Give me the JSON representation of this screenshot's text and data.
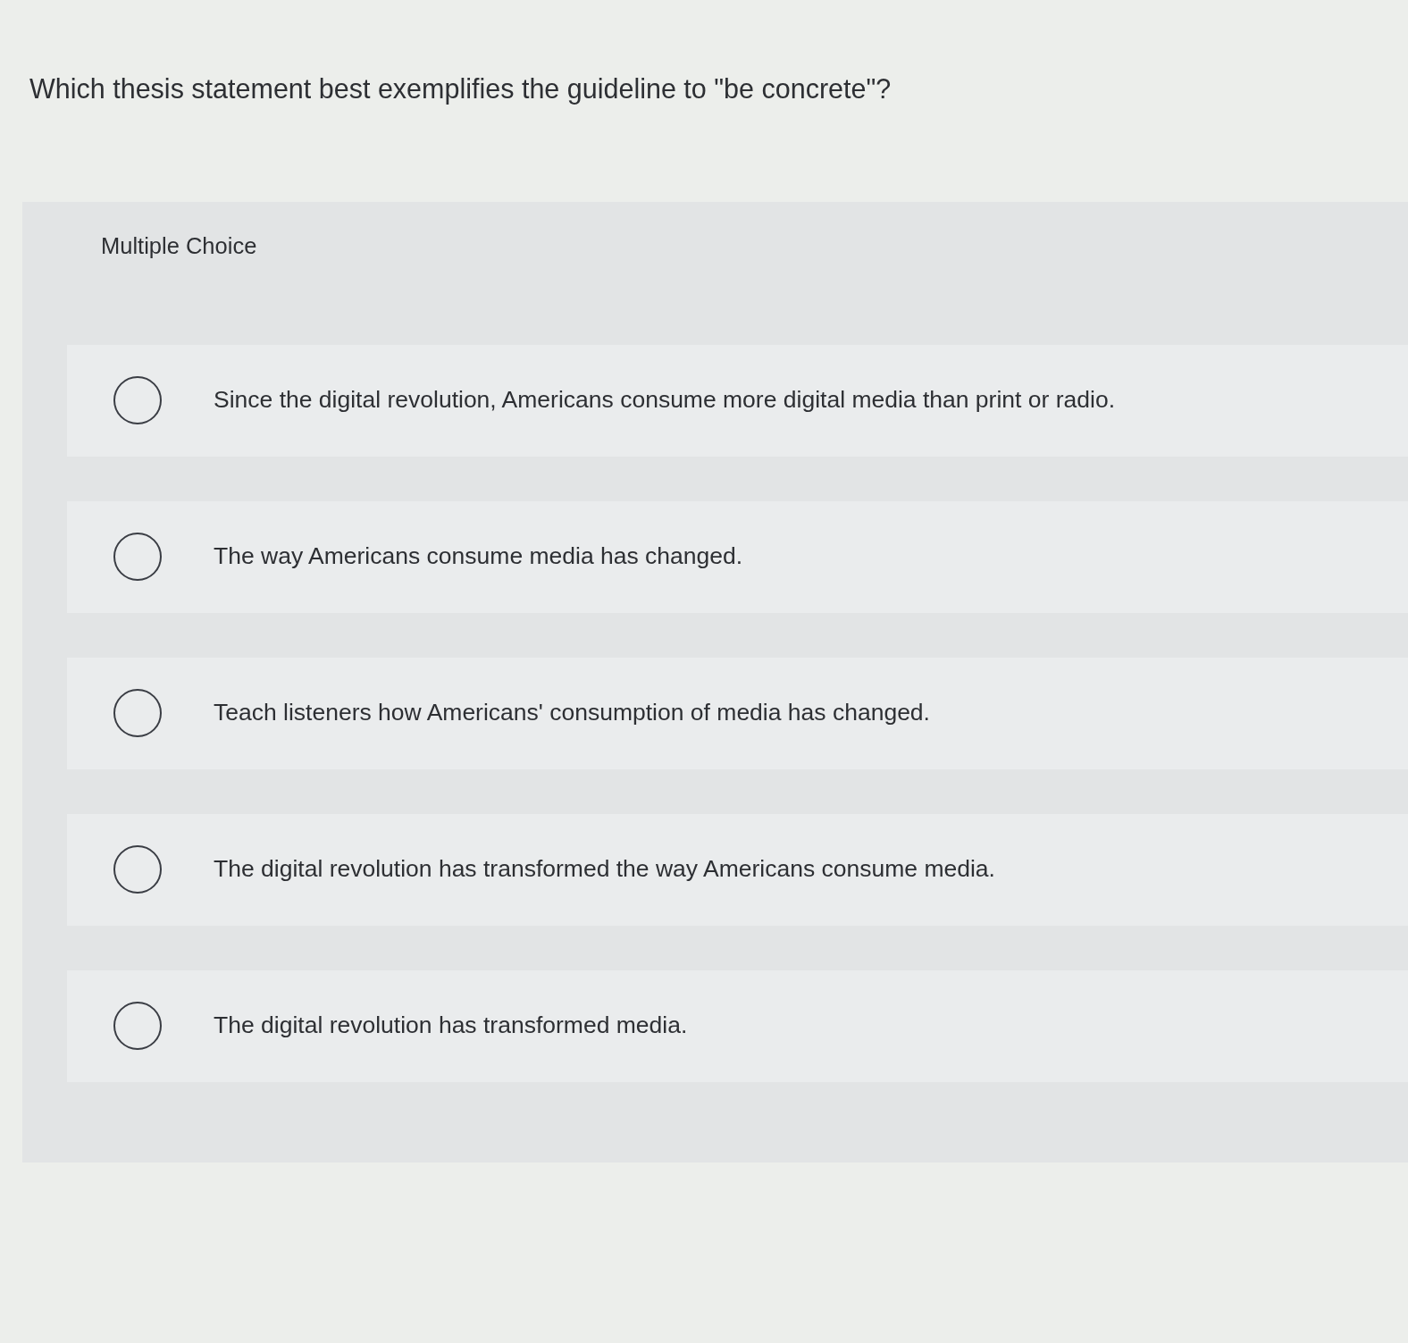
{
  "question": "Which thesis statement best exemplifies the guideline to \"be concrete\"?",
  "panel": {
    "heading": "Multiple Choice",
    "options": [
      {
        "text": "Since the digital revolution, Americans consume more digital media than print or radio.",
        "selected": false
      },
      {
        "text": "The way Americans consume media has changed.",
        "selected": false
      },
      {
        "text": "Teach listeners how Americans' consumption of media has changed.",
        "selected": false
      },
      {
        "text": "The digital revolution has transformed the way Americans consume media.",
        "selected": false
      },
      {
        "text": "The digital revolution has transformed media.",
        "selected": false
      }
    ]
  }
}
